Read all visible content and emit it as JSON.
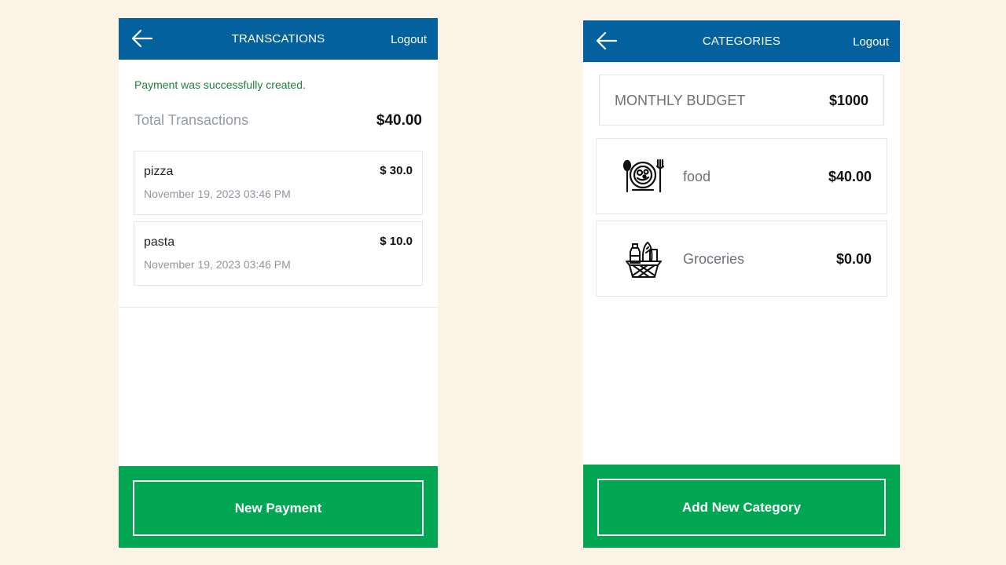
{
  "left_screen": {
    "header": {
      "back_icon": "arrow-left-icon",
      "title": "TRANSCATIONS",
      "logout_label": "Logout"
    },
    "notice": "Payment was successfully created.",
    "total_label": "Total Transactions",
    "total_value": "$40.00",
    "transactions": [
      {
        "name": "pizza",
        "date": "November 19, 2023 03:46 PM",
        "amount": "$ 30.0"
      },
      {
        "name": "pasta",
        "date": "November 19, 2023 03:46 PM",
        "amount": "$ 10.0"
      }
    ],
    "footer_button": "New Payment"
  },
  "right_screen": {
    "header": {
      "back_icon": "arrow-left-icon",
      "title": "CATEGORIES",
      "logout_label": "Logout"
    },
    "budget_label": "MONTHLY BUDGET",
    "budget_value": "$1000",
    "categories": [
      {
        "name": "food",
        "amount": "$40.00",
        "icon": "food-plate-icon"
      },
      {
        "name": "Groceries",
        "amount": "$0.00",
        "icon": "grocery-basket-icon"
      }
    ],
    "footer_button": "Add New Category"
  },
  "colors": {
    "page_background": "#fdf4e7",
    "header_blue": "#03619e",
    "action_green": "#00a651",
    "success_text": "#1f7f3a"
  }
}
